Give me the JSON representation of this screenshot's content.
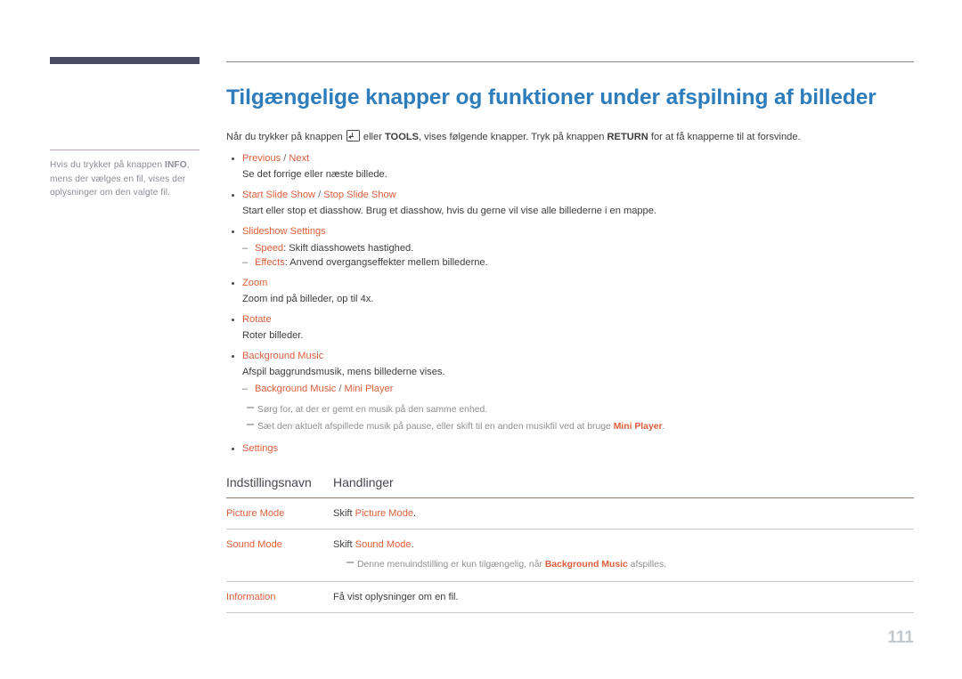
{
  "sidebar": {
    "note_lines": [
      "Hvis du trykker på knappen INFO, mens der vælges en fil, vises der oplysninger om den valgte fil."
    ],
    "note_bold_term": "INFO"
  },
  "main": {
    "title": "Tilgængelige knapper og funktioner under afspilning af billeder",
    "intro_part1": "Når du trykker på knappen",
    "intro_icon": "enter-key-icon",
    "intro_part2": "eller",
    "intro_tools": "TOOLS",
    "intro_part3": ", vises følgende knapper. Tryk på knappen",
    "intro_return": "RETURN",
    "intro_part4": "for at få knapperne til at forsvinde.",
    "bullets": [
      {
        "title_a": "Previous",
        "sep": " / ",
        "title_b": "Next",
        "desc": "Se det forrige eller næste billede."
      },
      {
        "title_a": "Start Slide Show",
        "sep": " / ",
        "title_b": "Stop Slide Show",
        "desc": "Start eller stop et diasshow. Brug et diasshow, hvis du gerne vil vise alle billederne i en mappe."
      },
      {
        "title_a": "Slideshow Settings",
        "sub": [
          {
            "key": "Speed",
            "text": ": Skift diasshowets hastighed."
          },
          {
            "key": "Effects",
            "text": ": Anvend overgangseffekter mellem billederne."
          }
        ]
      },
      {
        "title_a": "Zoom",
        "desc": "Zoom ind på billeder, op til 4x."
      },
      {
        "title_a": "Rotate",
        "desc": "Roter billeder."
      },
      {
        "title_a": "Background Music",
        "desc": "Afspil baggrundsmusik, mens billederne vises.",
        "sub": [
          {
            "key": "Background Music",
            "sep": " / ",
            "key2": "Mini Player",
            "text": ""
          }
        ],
        "notes": [
          {
            "pre": "Sørg for, at der er gemt en musik på den samme enhed.",
            "bold": "",
            "post": ""
          },
          {
            "pre": "Sæt den aktuelt afspillede musik på pause, eller skift til en anden musikfil ved at bruge ",
            "bold": "Mini Player",
            "post": "."
          }
        ]
      },
      {
        "title_a": "Settings"
      }
    ],
    "table": {
      "headers": [
        "Indstillingsnavn",
        "Handlinger"
      ],
      "rows": [
        {
          "name": "Picture Mode",
          "action_pre": "Skift ",
          "action_inline": "Picture Mode",
          "action_post": "."
        },
        {
          "name": "Sound Mode",
          "action_pre": "Skift ",
          "action_inline": "Sound Mode",
          "action_post": ".",
          "note_pre": "Denne menuindstilling er kun tilgængelig, når ",
          "note_bold": "Background Music",
          "note_post": " afspilles."
        },
        {
          "name": "Information",
          "action_pre": "Få vist oplysninger om en fil.",
          "action_inline": "",
          "action_post": ""
        }
      ]
    }
  },
  "footer": {
    "page_number": "111"
  },
  "colors": {
    "heading_blue": "#2d7cbb",
    "accent_orange": "#dd5f3c",
    "sidebar_bar": "#474b63",
    "note_gray": "#8f8f8f",
    "page_num_gray": "#c3c8cc"
  }
}
